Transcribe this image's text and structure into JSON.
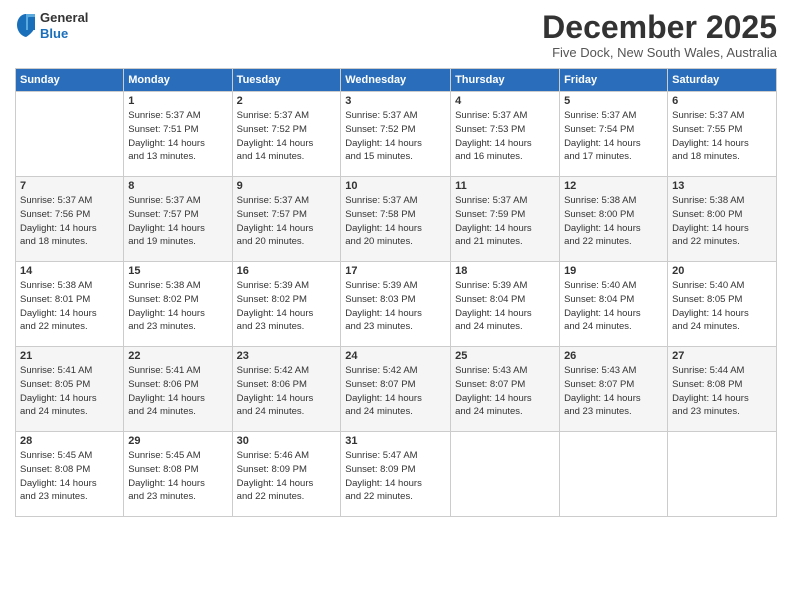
{
  "logo": {
    "general": "General",
    "blue": "Blue"
  },
  "title": "December 2025",
  "location": "Five Dock, New South Wales, Australia",
  "days_of_week": [
    "Sunday",
    "Monday",
    "Tuesday",
    "Wednesday",
    "Thursday",
    "Friday",
    "Saturday"
  ],
  "weeks": [
    [
      {
        "day": "",
        "sunrise": "",
        "sunset": "",
        "daylight": ""
      },
      {
        "day": "1",
        "sunrise": "Sunrise: 5:37 AM",
        "sunset": "Sunset: 7:51 PM",
        "daylight": "Daylight: 14 hours and 13 minutes."
      },
      {
        "day": "2",
        "sunrise": "Sunrise: 5:37 AM",
        "sunset": "Sunset: 7:52 PM",
        "daylight": "Daylight: 14 hours and 14 minutes."
      },
      {
        "day": "3",
        "sunrise": "Sunrise: 5:37 AM",
        "sunset": "Sunset: 7:52 PM",
        "daylight": "Daylight: 14 hours and 15 minutes."
      },
      {
        "day": "4",
        "sunrise": "Sunrise: 5:37 AM",
        "sunset": "Sunset: 7:53 PM",
        "daylight": "Daylight: 14 hours and 16 minutes."
      },
      {
        "day": "5",
        "sunrise": "Sunrise: 5:37 AM",
        "sunset": "Sunset: 7:54 PM",
        "daylight": "Daylight: 14 hours and 17 minutes."
      },
      {
        "day": "6",
        "sunrise": "Sunrise: 5:37 AM",
        "sunset": "Sunset: 7:55 PM",
        "daylight": "Daylight: 14 hours and 18 minutes."
      }
    ],
    [
      {
        "day": "7",
        "sunrise": "Sunrise: 5:37 AM",
        "sunset": "Sunset: 7:56 PM",
        "daylight": "Daylight: 14 hours and 18 minutes."
      },
      {
        "day": "8",
        "sunrise": "Sunrise: 5:37 AM",
        "sunset": "Sunset: 7:57 PM",
        "daylight": "Daylight: 14 hours and 19 minutes."
      },
      {
        "day": "9",
        "sunrise": "Sunrise: 5:37 AM",
        "sunset": "Sunset: 7:57 PM",
        "daylight": "Daylight: 14 hours and 20 minutes."
      },
      {
        "day": "10",
        "sunrise": "Sunrise: 5:37 AM",
        "sunset": "Sunset: 7:58 PM",
        "daylight": "Daylight: 14 hours and 20 minutes."
      },
      {
        "day": "11",
        "sunrise": "Sunrise: 5:37 AM",
        "sunset": "Sunset: 7:59 PM",
        "daylight": "Daylight: 14 hours and 21 minutes."
      },
      {
        "day": "12",
        "sunrise": "Sunrise: 5:38 AM",
        "sunset": "Sunset: 8:00 PM",
        "daylight": "Daylight: 14 hours and 22 minutes."
      },
      {
        "day": "13",
        "sunrise": "Sunrise: 5:38 AM",
        "sunset": "Sunset: 8:00 PM",
        "daylight": "Daylight: 14 hours and 22 minutes."
      }
    ],
    [
      {
        "day": "14",
        "sunrise": "Sunrise: 5:38 AM",
        "sunset": "Sunset: 8:01 PM",
        "daylight": "Daylight: 14 hours and 22 minutes."
      },
      {
        "day": "15",
        "sunrise": "Sunrise: 5:38 AM",
        "sunset": "Sunset: 8:02 PM",
        "daylight": "Daylight: 14 hours and 23 minutes."
      },
      {
        "day": "16",
        "sunrise": "Sunrise: 5:39 AM",
        "sunset": "Sunset: 8:02 PM",
        "daylight": "Daylight: 14 hours and 23 minutes."
      },
      {
        "day": "17",
        "sunrise": "Sunrise: 5:39 AM",
        "sunset": "Sunset: 8:03 PM",
        "daylight": "Daylight: 14 hours and 23 minutes."
      },
      {
        "day": "18",
        "sunrise": "Sunrise: 5:39 AM",
        "sunset": "Sunset: 8:04 PM",
        "daylight": "Daylight: 14 hours and 24 minutes."
      },
      {
        "day": "19",
        "sunrise": "Sunrise: 5:40 AM",
        "sunset": "Sunset: 8:04 PM",
        "daylight": "Daylight: 14 hours and 24 minutes."
      },
      {
        "day": "20",
        "sunrise": "Sunrise: 5:40 AM",
        "sunset": "Sunset: 8:05 PM",
        "daylight": "Daylight: 14 hours and 24 minutes."
      }
    ],
    [
      {
        "day": "21",
        "sunrise": "Sunrise: 5:41 AM",
        "sunset": "Sunset: 8:05 PM",
        "daylight": "Daylight: 14 hours and 24 minutes."
      },
      {
        "day": "22",
        "sunrise": "Sunrise: 5:41 AM",
        "sunset": "Sunset: 8:06 PM",
        "daylight": "Daylight: 14 hours and 24 minutes."
      },
      {
        "day": "23",
        "sunrise": "Sunrise: 5:42 AM",
        "sunset": "Sunset: 8:06 PM",
        "daylight": "Daylight: 14 hours and 24 minutes."
      },
      {
        "day": "24",
        "sunrise": "Sunrise: 5:42 AM",
        "sunset": "Sunset: 8:07 PM",
        "daylight": "Daylight: 14 hours and 24 minutes."
      },
      {
        "day": "25",
        "sunrise": "Sunrise: 5:43 AM",
        "sunset": "Sunset: 8:07 PM",
        "daylight": "Daylight: 14 hours and 24 minutes."
      },
      {
        "day": "26",
        "sunrise": "Sunrise: 5:43 AM",
        "sunset": "Sunset: 8:07 PM",
        "daylight": "Daylight: 14 hours and 23 minutes."
      },
      {
        "day": "27",
        "sunrise": "Sunrise: 5:44 AM",
        "sunset": "Sunset: 8:08 PM",
        "daylight": "Daylight: 14 hours and 23 minutes."
      }
    ],
    [
      {
        "day": "28",
        "sunrise": "Sunrise: 5:45 AM",
        "sunset": "Sunset: 8:08 PM",
        "daylight": "Daylight: 14 hours and 23 minutes."
      },
      {
        "day": "29",
        "sunrise": "Sunrise: 5:45 AM",
        "sunset": "Sunset: 8:08 PM",
        "daylight": "Daylight: 14 hours and 23 minutes."
      },
      {
        "day": "30",
        "sunrise": "Sunrise: 5:46 AM",
        "sunset": "Sunset: 8:09 PM",
        "daylight": "Daylight: 14 hours and 22 minutes."
      },
      {
        "day": "31",
        "sunrise": "Sunrise: 5:47 AM",
        "sunset": "Sunset: 8:09 PM",
        "daylight": "Daylight: 14 hours and 22 minutes."
      },
      {
        "day": "",
        "sunrise": "",
        "sunset": "",
        "daylight": ""
      },
      {
        "day": "",
        "sunrise": "",
        "sunset": "",
        "daylight": ""
      },
      {
        "day": "",
        "sunrise": "",
        "sunset": "",
        "daylight": ""
      }
    ]
  ]
}
